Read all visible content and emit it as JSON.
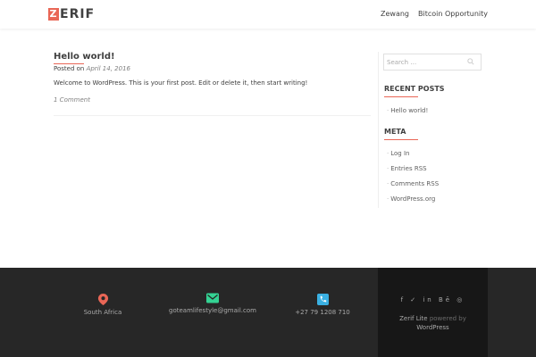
{
  "header": {
    "logo_letter": "Z",
    "logo_rest": "ERIF",
    "nav": [
      {
        "label": "Zewang"
      },
      {
        "label": "Bitcoin Opportunity"
      }
    ]
  },
  "post": {
    "title": "Hello world!",
    "posted_on_label": "Posted on ",
    "date": "April 14, 2016",
    "content": "Welcome to WordPress. This is your first post. Edit or delete it, then start writing!",
    "comments": "1 Comment"
  },
  "sidebar": {
    "search_placeholder": "Search …",
    "recent_title": "RECENT POSTS",
    "recent_items": [
      {
        "label": "Hello world!"
      }
    ],
    "meta_title": "META",
    "meta_items": [
      {
        "label": "Log In"
      },
      {
        "label": "Entries RSS"
      },
      {
        "label": "Comments RSS"
      },
      {
        "label": "WordPress.org"
      }
    ]
  },
  "footer": {
    "address": "South Africa",
    "email": "goteamlifestyle@gmail.com",
    "phone": "+27 79 1208 710",
    "social": "f ✓ in Bē ◎",
    "credit_name": "Zerif Lite",
    "credit_powered": " powered by",
    "credit_wp": "WordPress",
    "colors": {
      "address_icon": "#e96656",
      "email_icon": "#34d293",
      "phone_icon": "#3ab0e2",
      "accent": "#e96656"
    }
  }
}
